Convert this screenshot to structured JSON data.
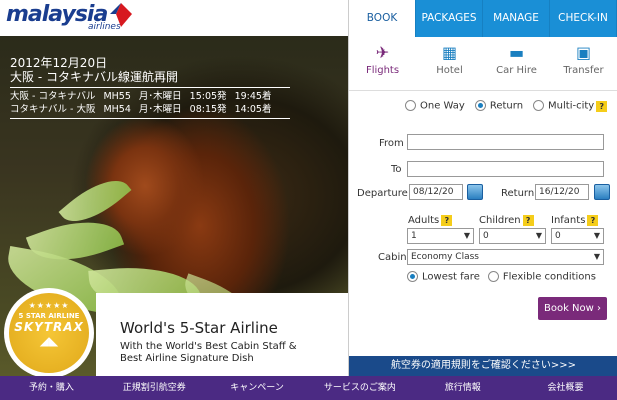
{
  "brand": {
    "name": "malaysia",
    "sub": "airlines"
  },
  "headline": {
    "date": "2012年12月20日",
    "route": "大阪 - コタキナバル線運航再開",
    "rows": [
      {
        "route": "大阪 - コタキナバル",
        "flight": "MH55",
        "days": "月･木曜日",
        "dep": "15:05発",
        "arr": "19:45着"
      },
      {
        "route": "コタキナバル - 大阪",
        "flight": "MH54",
        "days": "月･木曜日",
        "dep": "08:15発",
        "arr": "14:05着"
      }
    ]
  },
  "skytrax": {
    "stars": "★★★★★",
    "top": "5 STAR AIRLINE",
    "name": "SKYTRAX"
  },
  "award": {
    "title": "World's 5-Star Airline",
    "line1": "With the World's Best Cabin Staff &",
    "line2": "Best Airline Signature Dish"
  },
  "tabs": [
    "BOOK",
    "PACKAGES",
    "MANAGE",
    "CHECK-IN"
  ],
  "modes": [
    {
      "label": "Flights",
      "icon": "plane-icon"
    },
    {
      "label": "Hotel",
      "icon": "hotel-icon"
    },
    {
      "label": "Car Hire",
      "icon": "car-icon"
    },
    {
      "label": "Transfer",
      "icon": "bus-icon"
    }
  ],
  "trip": {
    "oneway": "One Way",
    "return": "Return",
    "multi": "Multi-city",
    "selected": "Return"
  },
  "form": {
    "from_label": "From",
    "to_label": "To",
    "dep_label": "Departure",
    "dep_value": "08/12/20",
    "ret_label": "Return",
    "ret_value": "16/12/20",
    "adults_label": "Adults",
    "adults": "1",
    "children_label": "Children",
    "children": "0",
    "infants_label": "Infants",
    "infants": "0",
    "cabin_label": "Cabin",
    "cabin": "Economy Class",
    "fare_lowest": "Lowest fare",
    "fare_flex": "Flexible conditions",
    "fare_selected": "Lowest fare",
    "book_label": "Book Now"
  },
  "rules_text": "航空券の適用規則をご確認ください>>>",
  "footer": [
    "予約・購入",
    "正規割引航空券",
    "キャンペーン",
    "サービスのご案内",
    "旅行情報",
    "会社概要"
  ],
  "colors": {
    "tab": "#1a8fd6",
    "footer": "#4b2a83",
    "book": "#7a2a7a",
    "rules": "#1a4a8a"
  }
}
